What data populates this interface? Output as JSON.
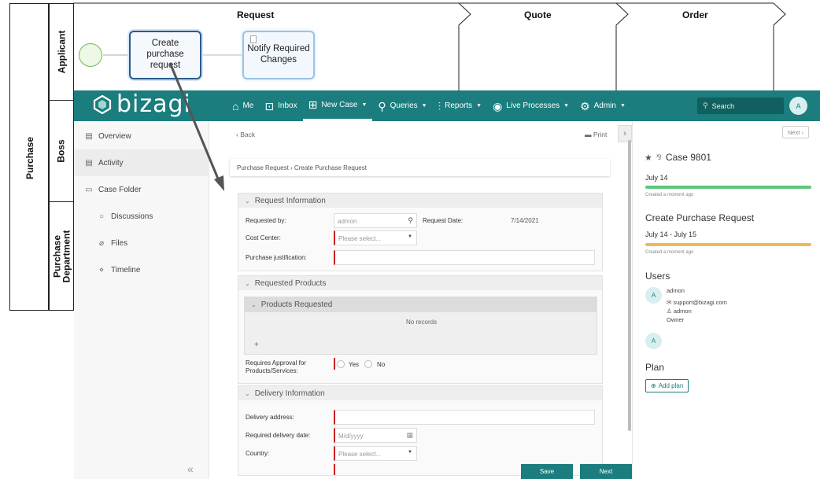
{
  "bpmn": {
    "pool_label": "Purchase",
    "lanes": [
      "Applicant",
      "Boss",
      "Purchase Department"
    ],
    "phases": [
      "Request",
      "Quote",
      "Order"
    ],
    "tasks": {
      "create": "Create purchase request",
      "notify": "Notify Required Changes"
    }
  },
  "topbar": {
    "logo": "bizagi",
    "nav": [
      {
        "label": "Me",
        "icon": "home-icon"
      },
      {
        "label": "Inbox",
        "icon": "inbox-icon"
      },
      {
        "label": "New Case",
        "icon": "new-case-icon"
      },
      {
        "label": "Queries",
        "icon": "search-icon"
      },
      {
        "label": "Reports",
        "icon": "chart-icon"
      },
      {
        "label": "Live Processes",
        "icon": "play-icon"
      },
      {
        "label": "Admin",
        "icon": "gear-icon"
      }
    ],
    "search_placeholder": "Search",
    "avatar": "A"
  },
  "sidebar": {
    "items": [
      "Overview",
      "Activity",
      "Case Folder",
      "Discussions",
      "Files",
      "Timeline"
    ],
    "collapse": "«"
  },
  "center": {
    "back": "Back",
    "print": "Print",
    "breadcrumb": "Purchase Request › Create Purchase Request",
    "request_info": {
      "title": "Request Information",
      "requested_by_label": "Requested by:",
      "requested_by_value": "admon",
      "request_date_label": "Request Date:",
      "request_date_value": "7/14/2021",
      "cost_center_label": "Cost Center:",
      "cost_center_placeholder": "Please select...",
      "justification_label": "Purchase justification:"
    },
    "requested_products": {
      "title": "Requested Products",
      "grid_title": "Products Requested",
      "empty": "No records",
      "add": "+",
      "approval_label_1": "Requires Approval for",
      "approval_label_2": "Products/Services:",
      "yes": "Yes",
      "no": "No"
    },
    "delivery": {
      "title": "Delivery Information",
      "address_label": "Delivery address:",
      "date_label": "Required delivery date:",
      "date_placeholder": "M/d/yyyy",
      "country_label": "Country:",
      "country_placeholder": "Please select..."
    },
    "save": "Save",
    "next": "Next"
  },
  "right": {
    "next_small": "Next ›",
    "case_title": "Case 9801",
    "date1": "July 14",
    "created1": "Created a moment ago",
    "activity_title": "Create Purchase Request",
    "date2": "July 14 - July 15",
    "created2": "Created a moment ago",
    "users_h": "Users",
    "user_initial": "A",
    "user_name": "admon",
    "user_email": "support@bizagi.com",
    "user_login": "admon",
    "user_role": "Owner",
    "plan_h": "Plan",
    "add_plan": "Add plan"
  },
  "colors": {
    "brand": "#1b7d7d",
    "progress_green": "#5cc87a",
    "progress_orange": "#f1b85a",
    "required": "#cc2222"
  }
}
